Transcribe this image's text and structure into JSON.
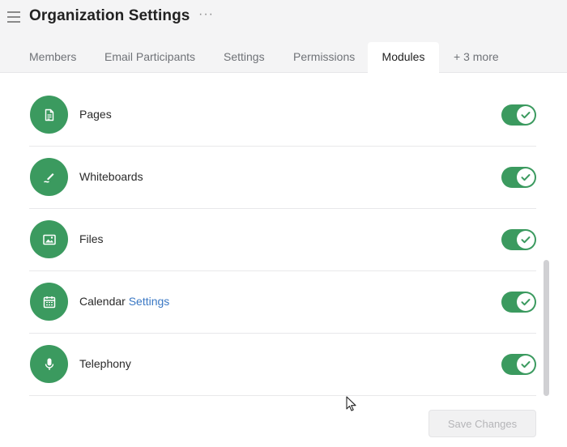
{
  "header": {
    "title": "Organization Settings",
    "more_label": "···"
  },
  "tabs": [
    {
      "label": "Members",
      "active": false
    },
    {
      "label": "Email Participants",
      "active": false
    },
    {
      "label": "Settings",
      "active": false
    },
    {
      "label": "Permissions",
      "active": false
    },
    {
      "label": "Modules",
      "active": true
    },
    {
      "label": "+ 3 more",
      "active": false
    }
  ],
  "modules": [
    {
      "label": "Pages",
      "icon": "document-icon",
      "enabled": true
    },
    {
      "label": "Whiteboards",
      "icon": "pen-icon",
      "enabled": true
    },
    {
      "label": "Files",
      "icon": "image-icon",
      "enabled": true
    },
    {
      "label": "Calendar",
      "link": "Settings",
      "icon": "calendar-icon",
      "enabled": true
    },
    {
      "label": "Telephony",
      "icon": "microphone-icon",
      "enabled": true
    }
  ],
  "footer": {
    "save_label": "Save Changes"
  },
  "colors": {
    "accent": "#3b9a5f",
    "link": "#3a78c4"
  }
}
